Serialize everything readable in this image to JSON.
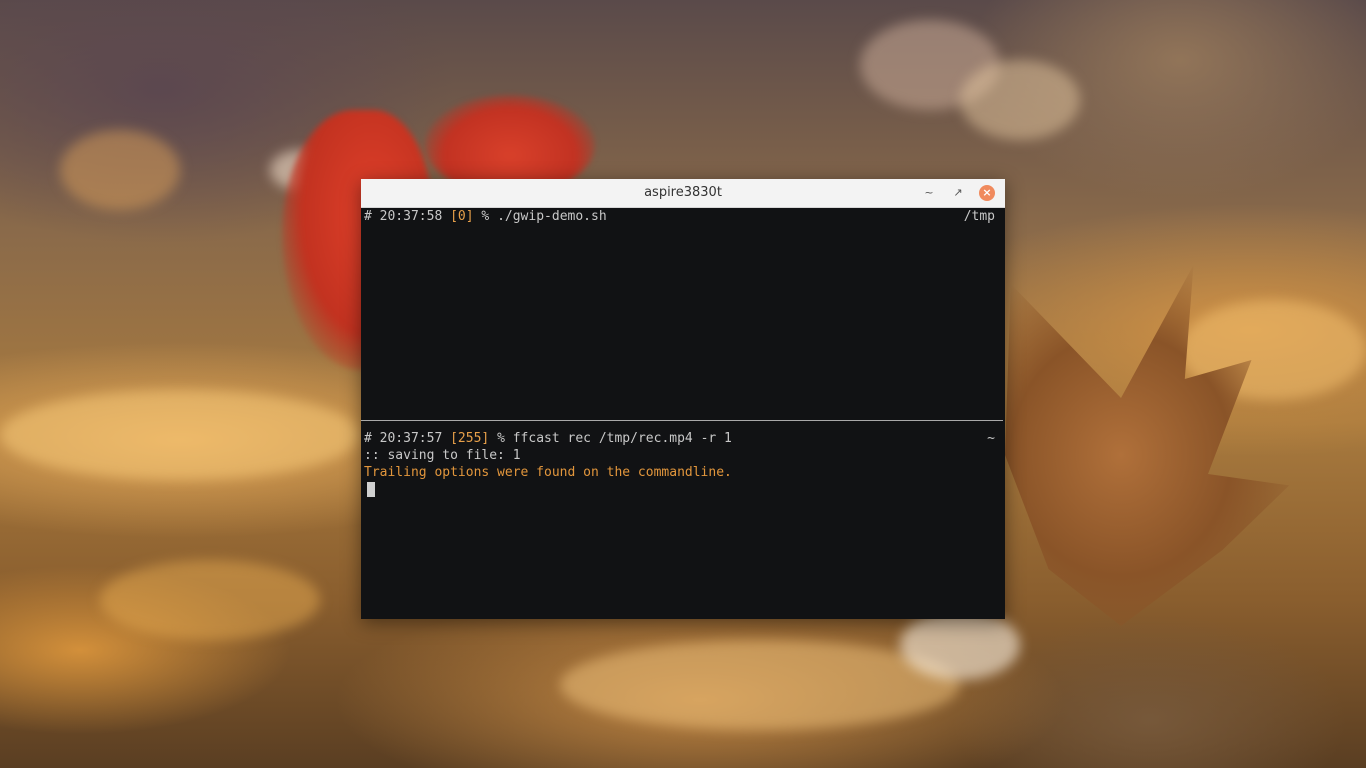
{
  "window": {
    "title": "aspire3830t",
    "minimize_glyph": "~",
    "maximize_glyph": "↗",
    "close_glyph": "×"
  },
  "pane_top": {
    "prompt_hash": "#",
    "time": "20:37:58",
    "status": "[0]",
    "prompt_symbol": "%",
    "command": "./gwip-demo.sh",
    "cwd": "/tmp"
  },
  "pane_bottom": {
    "prompt_hash": "#",
    "time": "20:37:57",
    "status": "[255]",
    "prompt_symbol": "%",
    "command": "ffcast rec /tmp/rec.mp4 -r 1",
    "cwd": "~",
    "output_line_1": ":: saving to file: 1",
    "output_line_2": "Trailing options were found on the commandline."
  },
  "colors": {
    "terminal_bg": "#111214",
    "status_color": "#e8a04a",
    "warning_color": "#e2963c",
    "close_button": "#f08a5d"
  }
}
